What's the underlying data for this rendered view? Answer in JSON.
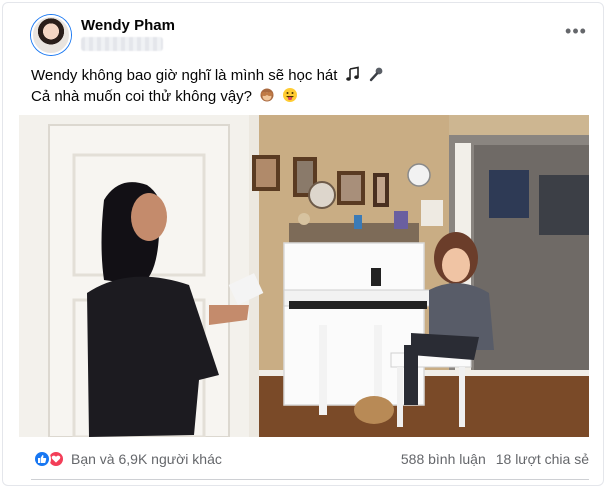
{
  "post": {
    "author": "Wendy Pham",
    "caption_line1": "Wendy không bao giờ nghĩ là mình sẽ học hát ",
    "caption_line2": "Cả nhà muốn coi thử không vậy? ",
    "emoji_line1": [
      "music-note",
      "microphone"
    ],
    "emoji_line2": [
      "see-no-evil-monkey",
      "grinning-tongue-face"
    ]
  },
  "footer": {
    "reactions_text": "Bạn và 6,9K người khác",
    "reaction_icons": [
      "like",
      "love"
    ],
    "comments": "588 bình luận",
    "shares": "18 lượt chia sẻ"
  },
  "colors": {
    "like": "#1877f2",
    "love": "#f33e58",
    "secondary_text": "#65676b"
  }
}
